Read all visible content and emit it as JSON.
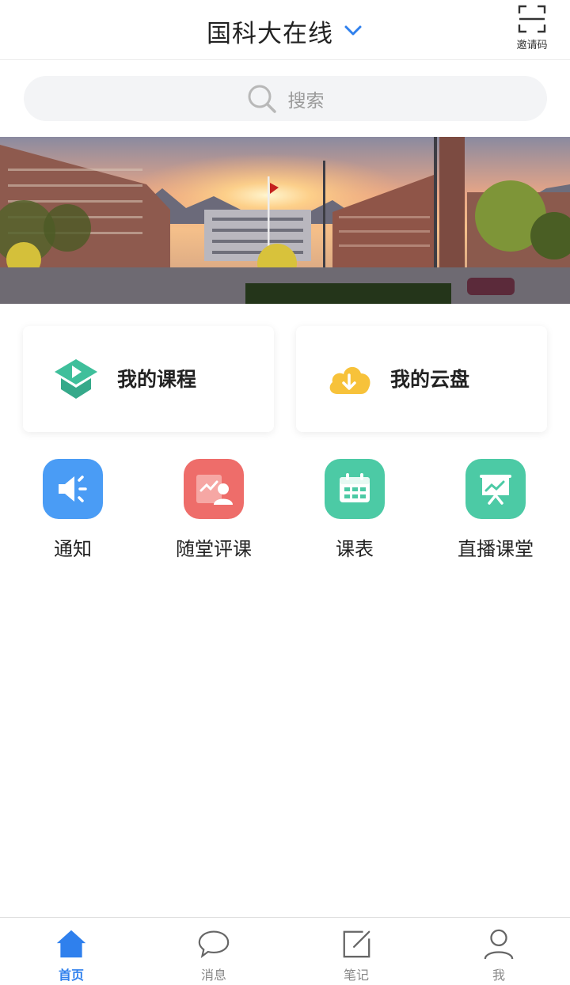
{
  "header": {
    "title": "国科大在线",
    "invite_label": "邀请码"
  },
  "search": {
    "placeholder": "搜索"
  },
  "banner": {
    "icon": "campus-photo"
  },
  "cards": [
    {
      "label": "我的课程",
      "icon": "course-cap-icon",
      "color": "#3fbf9b"
    },
    {
      "label": "我的云盘",
      "icon": "cloud-download-icon",
      "color": "#f7c23a"
    }
  ],
  "grid": [
    {
      "label": "通知",
      "icon": "speaker-icon",
      "color": "#4a9cf5"
    },
    {
      "label": "随堂评课",
      "icon": "class-review-icon",
      "color": "#ee6d6a"
    },
    {
      "label": "课表",
      "icon": "calendar-icon",
      "color": "#4ccaa5"
    },
    {
      "label": "直播课堂",
      "icon": "live-board-icon",
      "color": "#4ccaa5"
    }
  ],
  "bottom_nav": [
    {
      "label": "首页",
      "icon": "home-icon",
      "active": true
    },
    {
      "label": "消息",
      "icon": "chat-bubble-icon",
      "active": false
    },
    {
      "label": "笔记",
      "icon": "note-edit-icon",
      "active": false
    },
    {
      "label": "我",
      "icon": "user-icon",
      "active": false
    }
  ],
  "colors": {
    "accent": "#2f80ed",
    "inactive": "#888888"
  }
}
